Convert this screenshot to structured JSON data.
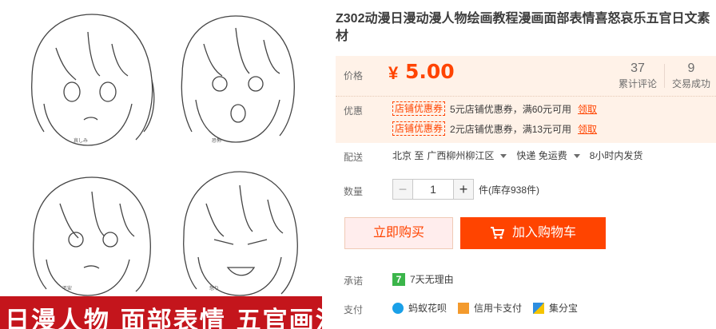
{
  "product": {
    "title": "Z302动漫日漫动漫人物绘画教程漫画面部表情喜怒哀乐五官日文素材",
    "image_banner_text": "日漫人物 面部表情 五官画法",
    "image_captions": [
      "哀しみ",
      "恐怖",
      "不安",
      "怒り"
    ]
  },
  "price": {
    "label": "价格",
    "currency": "¥",
    "value": "5.00",
    "stats": [
      {
        "num": "37",
        "text": "累计评论"
      },
      {
        "num": "9",
        "text": "交易成功"
      }
    ]
  },
  "promo": {
    "label": "优惠",
    "coupons": [
      {
        "tag": "店铺优惠券",
        "text": "5元店铺优惠券，满60元可用",
        "link": "领取"
      },
      {
        "tag": "店铺优惠券",
        "text": "2元店铺优惠券，满13元可用",
        "link": "领取"
      }
    ]
  },
  "shipping": {
    "label": "配送",
    "from": "北京 至",
    "to": "广西柳州柳江区",
    "method": "快递 免运费",
    "time": "8小时内发货"
  },
  "quantity": {
    "label": "数量",
    "minus": "−",
    "value": "1",
    "plus": "+",
    "stock": "件(库存938件)"
  },
  "buttons": {
    "buy": "立即购买",
    "cart": "加入购物车"
  },
  "promise": {
    "label": "承诺",
    "icon_char": "7",
    "text": "7天无理由"
  },
  "payment": {
    "label": "支付",
    "items": [
      "蚂蚁花呗",
      "信用卡支付",
      "集分宝"
    ]
  },
  "colors": {
    "accent": "#ff4400",
    "price_bg": "#fff2e8",
    "promise_green": "#3bb54a"
  }
}
